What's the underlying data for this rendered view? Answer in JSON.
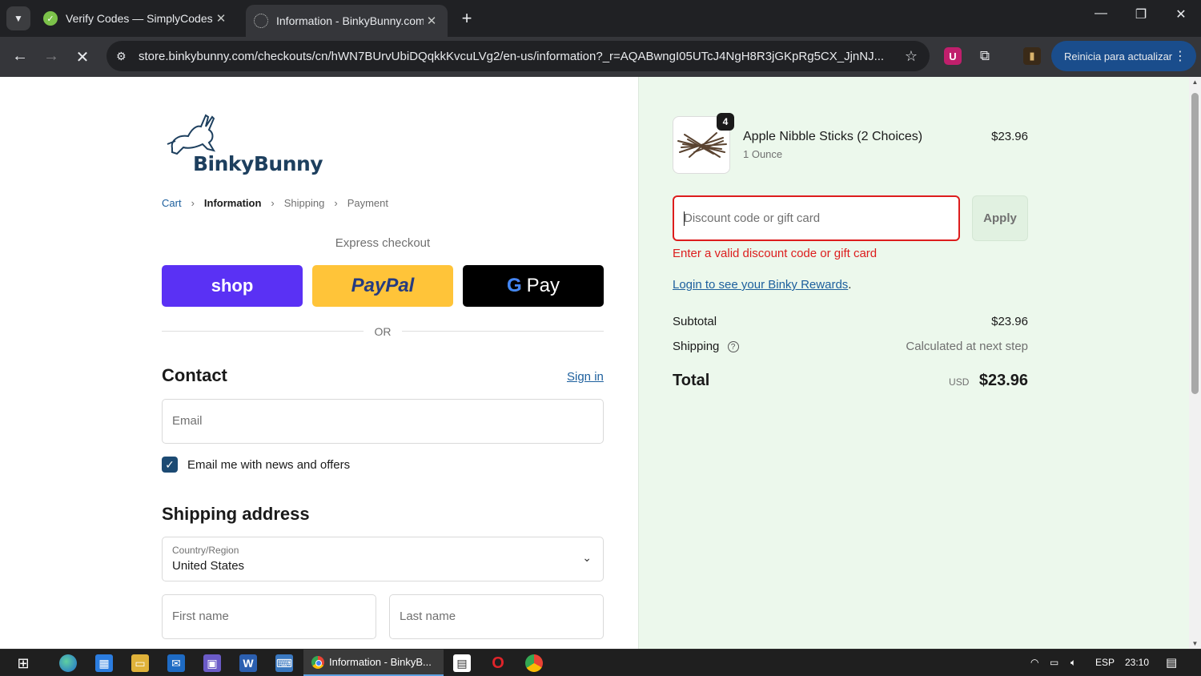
{
  "browser": {
    "tabs": [
      {
        "title": "Verify Codes — SimplyCodes",
        "active": false
      },
      {
        "title": "Information - BinkyBunny.com",
        "active": true
      }
    ],
    "url": "store.binkybunny.com/checkouts/cn/hWN7BUrvUbiDQqkkKvcuLVg2/en-us/information?_r=AQABwngI05UTcJ4NgH8R3jGKpRg5CX_JjnNJ...",
    "relaunch_label": "Reinicia para actualizar"
  },
  "checkout": {
    "brand": "BinkyBunny",
    "breadcrumb": {
      "cart": "Cart",
      "information": "Information",
      "shipping": "Shipping",
      "payment": "Payment"
    },
    "express_label": "Express checkout",
    "express": {
      "shop": "shop",
      "paypal": "PayPal",
      "gpay": "Pay"
    },
    "or_label": "OR",
    "contact": {
      "heading": "Contact",
      "sign_in": "Sign in",
      "email_placeholder": "Email",
      "newsletter_label": "Email me with news and offers",
      "newsletter_checked": true
    },
    "shipping": {
      "heading": "Shipping address",
      "country_label": "Country/Region",
      "country_value": "United States",
      "first_name_placeholder": "First name",
      "last_name_placeholder": "Last name"
    }
  },
  "summary": {
    "product": {
      "name": "Apple Nibble Sticks (2 Choices)",
      "variant": "1 Ounce",
      "price": "$23.96",
      "quantity": "4"
    },
    "discount_placeholder": "Discount code or gift card",
    "apply_label": "Apply",
    "error": "Enter a valid discount code or gift card",
    "rewards_link": "Login to see your Binky Rewards",
    "rewards_suffix": ".",
    "subtotal_label": "Subtotal",
    "subtotal_value": "$23.96",
    "shipping_label": "Shipping",
    "shipping_value": "Calculated at next step",
    "total_label": "Total",
    "currency": "USD",
    "total_value": "$23.96"
  },
  "taskbar": {
    "active_task": "Information - BinkyB...",
    "lang": "ESP",
    "time": "23:10"
  },
  "colors": {
    "shop": "#5a31f4",
    "paypal": "#ffc439",
    "error": "#dd1d1d",
    "link": "#1c5f9d",
    "summary_bg": "#ecf8ec"
  }
}
